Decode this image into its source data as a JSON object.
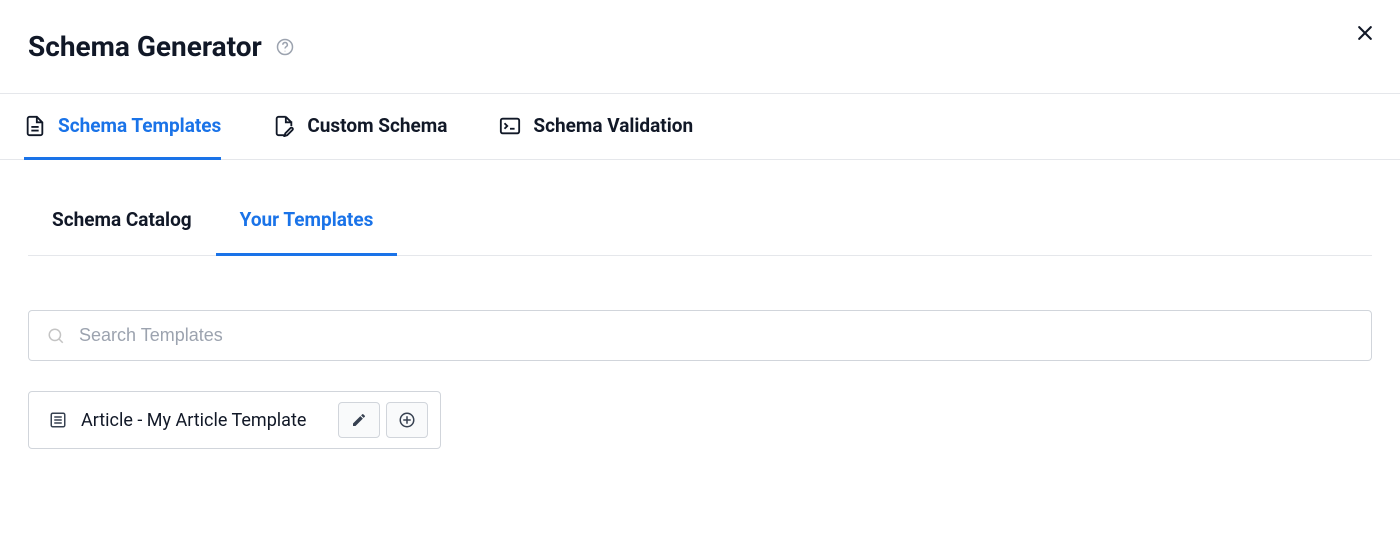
{
  "header": {
    "title": "Schema Generator"
  },
  "primaryTabs": {
    "schemaTemplates": "Schema Templates",
    "customSchema": "Custom Schema",
    "schemaValidation": "Schema Validation"
  },
  "secondaryTabs": {
    "schemaCatalog": "Schema Catalog",
    "yourTemplates": "Your Templates"
  },
  "search": {
    "placeholder": "Search Templates"
  },
  "templates": {
    "item0": {
      "label": "Article - My Article Template"
    }
  }
}
